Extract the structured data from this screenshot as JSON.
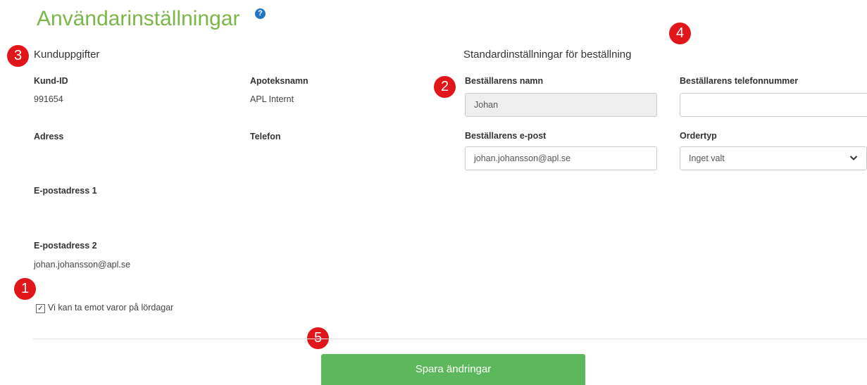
{
  "page": {
    "title": "Användarinställningar",
    "help_icon": "?"
  },
  "customer": {
    "section_title": "Kunduppgifter",
    "id_label": "Kund-ID",
    "id_value": "991654",
    "pharmacy_label": "Apoteksnamn",
    "pharmacy_value": "APL Internt",
    "address_label": "Adress",
    "phone_label": "Telefon",
    "email1_label": "E-postadress 1",
    "email2_label": "E-postadress 2",
    "email2_value": "johan.johansson@apl.se",
    "saturday_checkbox_label": "Vi kan ta emot varor på lördagar",
    "saturday_checked": true
  },
  "order_defaults": {
    "section_title": "Standardinställningar för beställning",
    "name_label": "Beställarens namn",
    "name_value": "Johan",
    "phone_label": "Beställarens telefonnummer",
    "phone_value": "",
    "email_label": "Beställarens e-post",
    "email_value": "johan.johansson@apl.se",
    "ordertype_label": "Ordertyp",
    "ordertype_value": "Inget valt"
  },
  "markers": [
    "1",
    "2",
    "3",
    "4",
    "5"
  ],
  "actions": {
    "save_label": "Spara ändringar"
  },
  "colors": {
    "title": "#7ab648",
    "save_button": "#5cb85c",
    "marker": "#e0161a",
    "help": "#1f77c4"
  }
}
